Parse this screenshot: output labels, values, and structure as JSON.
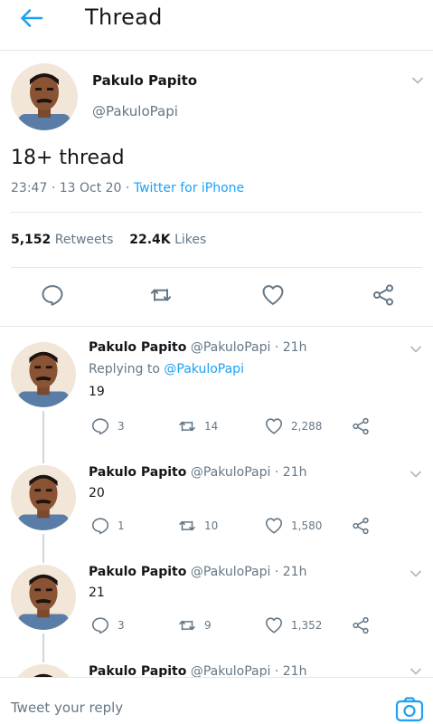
{
  "header": {
    "title": "Thread",
    "back_icon": "back-arrow-icon"
  },
  "main_tweet": {
    "name": "Pakulo Papito",
    "handle": "@PakuloPapi",
    "text": "18+ thread",
    "time": "23:47",
    "date": "13 Oct 20",
    "source": "Twitter for iPhone",
    "retweets_count": "5,152",
    "retweets_label": "Retweets",
    "likes_count": "22.4K",
    "likes_label": "Likes"
  },
  "replies": [
    {
      "name": "Pakulo Papito",
      "handle": "@PakuloPapi",
      "time": "21h",
      "replying_prefix": "Replying to",
      "replying_to": "@PakuloPapi",
      "text": "19",
      "replies": "3",
      "retweets": "14",
      "likes": "2,288"
    },
    {
      "name": "Pakulo Papito",
      "handle": "@PakuloPapi",
      "time": "21h",
      "text": "20",
      "replies": "1",
      "retweets": "10",
      "likes": "1,580"
    },
    {
      "name": "Pakulo Papito",
      "handle": "@PakuloPapi",
      "time": "21h",
      "text": "21",
      "replies": "3",
      "retweets": "9",
      "likes": "1,352"
    },
    {
      "name": "Pakulo Papito",
      "handle": "@PakuloPapi",
      "time": "21h"
    }
  ],
  "reply_bar": {
    "placeholder": "Tweet your reply"
  },
  "colors": {
    "accent": "#1da1f2",
    "muted": "#657786",
    "divider": "#e1e8ed"
  }
}
